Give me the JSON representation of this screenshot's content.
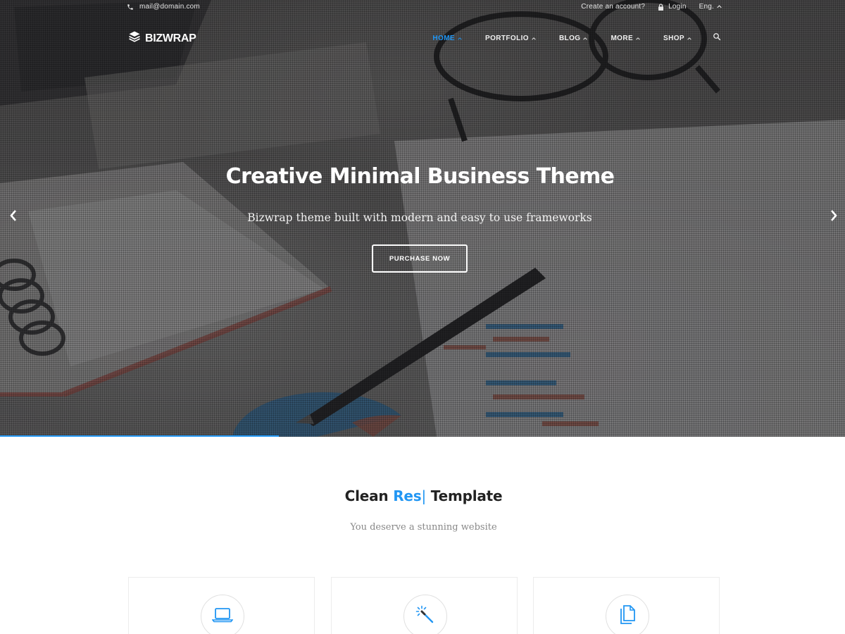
{
  "topbar": {
    "email": "mail@domain.com",
    "create_account": "Create an account?",
    "login": "Login",
    "language": "Eng."
  },
  "logo": {
    "text": "BIZWRAP"
  },
  "nav": {
    "items": [
      {
        "label": "HOME",
        "active": true
      },
      {
        "label": "PORTFOLIO",
        "active": false
      },
      {
        "label": "BLOG",
        "active": false
      },
      {
        "label": "MORE",
        "active": false
      },
      {
        "label": "SHOP",
        "active": false
      }
    ]
  },
  "hero": {
    "title": "Creative Minimal Business Theme",
    "subtitle": "Bizwrap theme built with modern and easy to use frameworks",
    "button": "PURCHASE NOW",
    "slide_progress_percent": 33
  },
  "section": {
    "title_start": "Clean",
    "title_highlight": "Res",
    "title_cursor": "|",
    "title_end": "Template",
    "subtitle": "You deserve a stunning website"
  },
  "features": [
    {
      "icon": "laptop-icon"
    },
    {
      "icon": "magic-wand-icon"
    },
    {
      "icon": "documents-icon"
    }
  ],
  "colors": {
    "accent": "#2196f3",
    "overlay": "#26262a",
    "text_muted": "#888888"
  }
}
